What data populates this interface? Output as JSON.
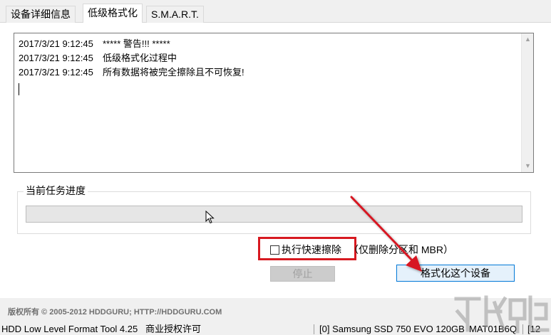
{
  "tabs": [
    {
      "label": "设备详细信息",
      "active": false
    },
    {
      "label": "低级格式化",
      "active": true
    },
    {
      "label": "S.M.A.R.T.",
      "active": false
    }
  ],
  "log": {
    "lines": [
      {
        "time": "2017/3/21 9:12:45",
        "message": "***** 警告!!! *****"
      },
      {
        "time": "2017/3/21 9:12:45",
        "message": "低级格式化过程中"
      },
      {
        "time": "2017/3/21 9:12:45",
        "message": "所有数据将被完全擦除且不可恢复!"
      }
    ]
  },
  "progress": {
    "label": "当前任务进度",
    "value": 0
  },
  "quick_wipe": {
    "label": "执行快速擦除",
    "note": "（仅删除分区和 MBR）",
    "checked": false
  },
  "buttons": {
    "stop": "停止",
    "format": "格式化这个设备"
  },
  "footer": {
    "copyright": "版权所有 © 2005-2012 HDDGURU; HTTP://HDDGURU.COM"
  },
  "statusbar": {
    "app": "HDD Low Level Format Tool 4.25",
    "license": "商业授权许可",
    "device": "[0]  Samsung SSD 750 EVO 120GB",
    "serial": "MAT01B6Q",
    "extra": "[12"
  },
  "colors": {
    "highlight": "#d71920",
    "accent": "#0078d7"
  }
}
